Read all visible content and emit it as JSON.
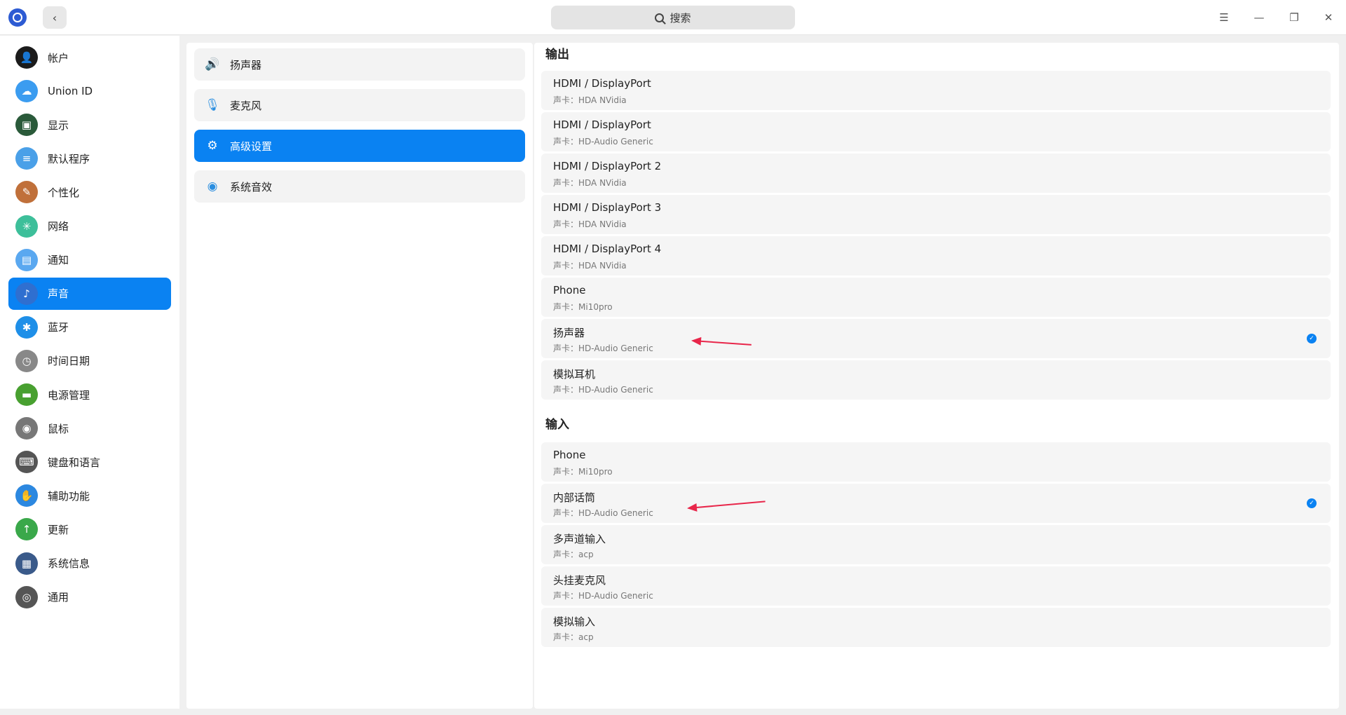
{
  "search": {
    "label": "搜索"
  },
  "window": {
    "menu": "☰",
    "minimize": "—",
    "maximize": "❐",
    "close": "✕",
    "back": "‹"
  },
  "sidebar": {
    "items": [
      {
        "label": "帐户",
        "icon": "account-icon",
        "color": "#1b1b1b"
      },
      {
        "label": "Union ID",
        "icon": "cloud-icon",
        "color": "#3b9cf0"
      },
      {
        "label": "显示",
        "icon": "display-icon",
        "color": "#2a5a3a"
      },
      {
        "label": "默认程序",
        "icon": "default-apps-icon",
        "color": "#4aa0e8"
      },
      {
        "label": "个性化",
        "icon": "personalization-icon",
        "color": "#c0703a"
      },
      {
        "label": "网络",
        "icon": "network-icon",
        "color": "#3dbf9a"
      },
      {
        "label": "通知",
        "icon": "notification-icon",
        "color": "#5aa8f0"
      },
      {
        "label": "声音",
        "icon": "sound-icon",
        "color": "#2f6fd0"
      },
      {
        "label": "蓝牙",
        "icon": "bluetooth-icon",
        "color": "#1e8fe8"
      },
      {
        "label": "时间日期",
        "icon": "clock-icon",
        "color": "#888888"
      },
      {
        "label": "电源管理",
        "icon": "power-icon",
        "color": "#48a030"
      },
      {
        "label": "鼠标",
        "icon": "mouse-icon",
        "color": "#777777"
      },
      {
        "label": "键盘和语言",
        "icon": "keyboard-icon",
        "color": "#555555"
      },
      {
        "label": "辅助功能",
        "icon": "accessibility-icon",
        "color": "#2c88e0"
      },
      {
        "label": "更新",
        "icon": "update-icon",
        "color": "#3aa84a"
      },
      {
        "label": "系统信息",
        "icon": "system-info-icon",
        "color": "#3a5a8a"
      },
      {
        "label": "通用",
        "icon": "general-icon",
        "color": "#555555"
      }
    ],
    "active_index": 7
  },
  "subnav": {
    "items": [
      {
        "label": "扬声器",
        "icon": "speaker-icon"
      },
      {
        "label": "麦克风",
        "icon": "microphone-icon"
      },
      {
        "label": "高级设置",
        "icon": "gear-icon"
      },
      {
        "label": "系统音效",
        "icon": "system-sound-icon"
      }
    ],
    "active_index": 2
  },
  "output": {
    "title": "输出",
    "devices": [
      {
        "name": "HDMI / DisplayPort",
        "card": "声卡：HDA NVidia",
        "selected": false
      },
      {
        "name": "HDMI / DisplayPort",
        "card": "声卡：HD-Audio Generic",
        "selected": false
      },
      {
        "name": "HDMI / DisplayPort 2",
        "card": "声卡：HDA NVidia",
        "selected": false
      },
      {
        "name": "HDMI / DisplayPort 3",
        "card": "声卡：HDA NVidia",
        "selected": false
      },
      {
        "name": "HDMI / DisplayPort 4",
        "card": "声卡：HDA NVidia",
        "selected": false
      },
      {
        "name": "Phone",
        "card": "声卡：Mi10pro",
        "selected": false
      },
      {
        "name": "扬声器",
        "card": "声卡：HD-Audio Generic",
        "selected": true
      },
      {
        "name": "模拟耳机",
        "card": "声卡：HD-Audio Generic",
        "selected": false
      }
    ]
  },
  "input": {
    "title": "输入",
    "devices": [
      {
        "name": "Phone",
        "card": "声卡：Mi10pro",
        "selected": false
      },
      {
        "name": "内部话筒",
        "card": "声卡：HD-Audio Generic",
        "selected": true
      },
      {
        "name": "多声道输入",
        "card": "声卡：acp",
        "selected": false
      },
      {
        "name": "头挂麦克风",
        "card": "声卡：HD-Audio Generic",
        "selected": false
      },
      {
        "name": "模拟输入",
        "card": "声卡：acp",
        "selected": false
      }
    ]
  },
  "colors": {
    "accent": "#0a82f2",
    "annotation": "#e8264a"
  }
}
